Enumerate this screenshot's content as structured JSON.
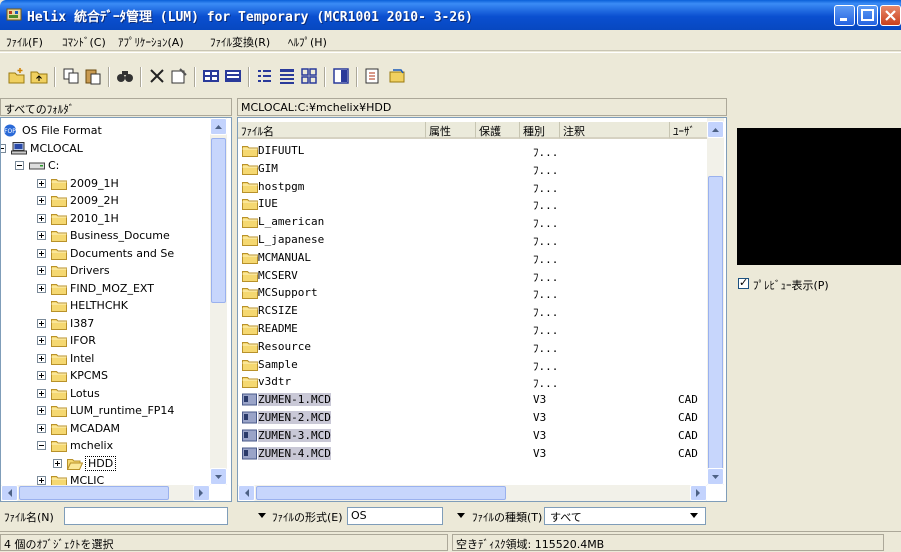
{
  "window": {
    "title": "Helix 統合ﾃﾞｰﾀ管理 (LUM) for Temporary (MCR1001 2010- 3-26)",
    "accent": "#0a4fd0"
  },
  "menu": [
    "ﾌｧｲﾙ(F)",
    "ｺﾏﾝﾄﾞ(C)",
    "ｱﾌﾟﾘｹｰｼｮﾝ(A)",
    "ﾌｧｲﾙ変換(R)",
    "ﾍﾙﾌﾟ(H)"
  ],
  "toolbar_icons": [
    "new-folder-icon",
    "up-folder-icon",
    "copy-icon",
    "paste-icon",
    "find-icon",
    "delete-icon",
    "properties-icon",
    "large-icons-icon",
    "small-icons-icon",
    "list-icon",
    "details-icon",
    "thumbnails-icon",
    "preview-pane-icon",
    "convert-icon",
    "refresh-icon"
  ],
  "folder_pane": {
    "header": "すべてのﾌｫﾙﾀﾞ",
    "items": [
      {
        "label": "OS File Format",
        "expander": "",
        "icon": "os-icon"
      },
      {
        "label": "MCLOCAL",
        "expander": "minus",
        "icon": "computer-icon"
      },
      {
        "label": "C:",
        "expander": "minus",
        "icon": "drive-icon"
      },
      {
        "label": "2009_1H",
        "expander": "plus",
        "icon": "folder-icon"
      },
      {
        "label": "2009_2H",
        "expander": "plus",
        "icon": "folder-icon"
      },
      {
        "label": "2010_1H",
        "expander": "plus",
        "icon": "folder-icon"
      },
      {
        "label": "Business_Docume",
        "expander": "plus",
        "icon": "folder-icon"
      },
      {
        "label": "Documents and Se",
        "expander": "plus",
        "icon": "folder-icon"
      },
      {
        "label": "Drivers",
        "expander": "plus",
        "icon": "folder-icon"
      },
      {
        "label": "FIND_MOZ_EXT",
        "expander": "plus",
        "icon": "folder-icon"
      },
      {
        "label": "HELTHCHK",
        "expander": "",
        "icon": "folder-icon"
      },
      {
        "label": "I387",
        "expander": "plus",
        "icon": "folder-icon"
      },
      {
        "label": "IFOR",
        "expander": "plus",
        "icon": "folder-icon"
      },
      {
        "label": "Intel",
        "expander": "plus",
        "icon": "folder-icon"
      },
      {
        "label": "KPCMS",
        "expander": "plus",
        "icon": "folder-icon"
      },
      {
        "label": "Lotus",
        "expander": "plus",
        "icon": "folder-icon"
      },
      {
        "label": "LUM_runtime_FP14",
        "expander": "plus",
        "icon": "folder-icon"
      },
      {
        "label": "MCADAM",
        "expander": "plus",
        "icon": "folder-icon"
      },
      {
        "label": "mchelix",
        "expander": "minus",
        "icon": "folder-icon"
      },
      {
        "label": "HDD",
        "expander": "plus",
        "icon": "open-folder-icon"
      },
      {
        "label": "MCLIC",
        "expander": "plus",
        "icon": "folder-icon"
      }
    ]
  },
  "file_pane": {
    "path": "MCLOCAL:C:¥mchelix¥HDD",
    "columns": [
      "ﾌｧｲﾙ名",
      "属性",
      "保護",
      "種別",
      "注釈",
      "ﾕｰｻﾞ"
    ],
    "rows": [
      {
        "name": "DIFUUTL",
        "type": "ﾌ...",
        "user": "",
        "kind": "folder",
        "selected": false
      },
      {
        "name": "GIM",
        "type": "ﾌ...",
        "user": "",
        "kind": "folder",
        "selected": false
      },
      {
        "name": "hostpgm",
        "type": "ﾌ...",
        "user": "",
        "kind": "folder",
        "selected": false
      },
      {
        "name": "IUE",
        "type": "ﾌ...",
        "user": "",
        "kind": "folder",
        "selected": false
      },
      {
        "name": "L_american",
        "type": "ﾌ...",
        "user": "",
        "kind": "folder",
        "selected": false
      },
      {
        "name": "L_japanese",
        "type": "ﾌ...",
        "user": "",
        "kind": "folder",
        "selected": false
      },
      {
        "name": "MCMANUAL",
        "type": "ﾌ...",
        "user": "",
        "kind": "folder",
        "selected": false
      },
      {
        "name": "MCSERV",
        "type": "ﾌ...",
        "user": "",
        "kind": "folder",
        "selected": false
      },
      {
        "name": "MCSupport",
        "type": "ﾌ...",
        "user": "",
        "kind": "folder",
        "selected": false
      },
      {
        "name": "RCSIZE",
        "type": "ﾌ...",
        "user": "",
        "kind": "folder",
        "selected": false
      },
      {
        "name": "README",
        "type": "ﾌ...",
        "user": "",
        "kind": "folder",
        "selected": false
      },
      {
        "name": "Resource",
        "type": "ﾌ...",
        "user": "",
        "kind": "folder",
        "selected": false
      },
      {
        "name": "Sample",
        "type": "ﾌ...",
        "user": "",
        "kind": "folder",
        "selected": false
      },
      {
        "name": "v3dtr",
        "type": "ﾌ...",
        "user": "",
        "kind": "folder",
        "selected": false
      },
      {
        "name": "ZUMEN-1.MCD",
        "type": "V3",
        "user": "CAD",
        "kind": "file",
        "selected": true
      },
      {
        "name": "ZUMEN-2.MCD",
        "type": "V3",
        "user": "CAD",
        "kind": "file",
        "selected": true
      },
      {
        "name": "ZUMEN-3.MCD",
        "type": "V3",
        "user": "CAD",
        "kind": "file",
        "selected": true
      },
      {
        "name": "ZUMEN-4.MCD",
        "type": "V3",
        "user": "CAD",
        "kind": "file",
        "selected": true
      }
    ]
  },
  "preview": {
    "checkbox_label": "ﾌﾟﾚﾋﾞｭｰ表示(P)",
    "checked": true
  },
  "bottom": {
    "filename_label": "ﾌｧｲﾙ名(N)",
    "filename_value": "",
    "format_label": "ﾌｧｲﾙの形式(E)",
    "format_value": "OS",
    "kind_label": "ﾌｧｲﾙの種類(T)",
    "kind_value": "すべて"
  },
  "status": {
    "left": "4 個のｵﾌﾞｼﾞｪｸﾄを選択",
    "right": "空きﾃﾞｨｽｸ領域: 115520.4MB"
  }
}
